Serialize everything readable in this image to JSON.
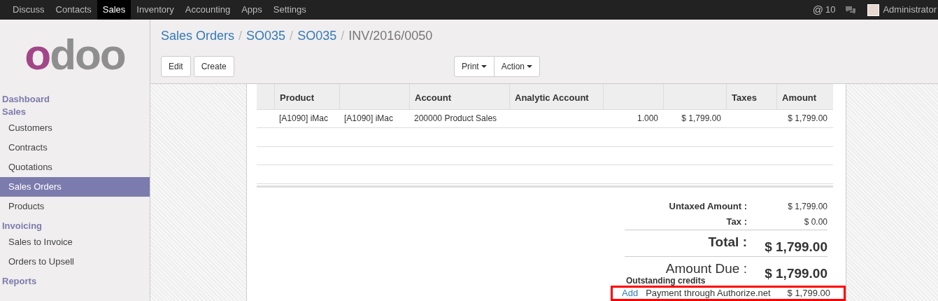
{
  "top_menu": [
    {
      "label": "Discuss",
      "selected": false
    },
    {
      "label": "Contacts",
      "selected": false
    },
    {
      "label": "Sales",
      "selected": true
    },
    {
      "label": "Inventory",
      "selected": false
    },
    {
      "label": "Accounting",
      "selected": false
    },
    {
      "label": "Apps",
      "selected": false
    },
    {
      "label": "Settings",
      "selected": false
    }
  ],
  "notifications": {
    "mention_icon": "@",
    "count": "10"
  },
  "user": {
    "name": "Administrator"
  },
  "logo": {
    "text": "odoo"
  },
  "sidebar": [
    {
      "kind": "heading",
      "label": "Dashboard",
      "selected": false
    },
    {
      "kind": "heading",
      "label": "Sales",
      "selected": false
    },
    {
      "kind": "item",
      "label": "Customers",
      "selected": false
    },
    {
      "kind": "item",
      "label": "Contracts",
      "selected": false
    },
    {
      "kind": "item",
      "label": "Quotations",
      "selected": false
    },
    {
      "kind": "item",
      "label": "Sales Orders",
      "selected": true
    },
    {
      "kind": "item",
      "label": "Products",
      "selected": false
    },
    {
      "kind": "heading",
      "label": "Invoicing",
      "selected": false
    },
    {
      "kind": "item",
      "label": "Sales to Invoice",
      "selected": false
    },
    {
      "kind": "item",
      "label": "Orders to Upsell",
      "selected": false
    },
    {
      "kind": "heading",
      "label": "Reports",
      "selected": false
    }
  ],
  "breadcrumb_separator": "/",
  "breadcrumbs": [
    {
      "label": "Sales Orders",
      "kind": "link"
    },
    {
      "label": "SO035",
      "kind": "link"
    },
    {
      "label": "SO035",
      "kind": "link"
    },
    {
      "label": "INV/2016/0050",
      "kind": "current"
    }
  ],
  "buttons": [
    "Edit",
    "Create"
  ],
  "dropdowns": [
    "Print",
    "Action"
  ],
  "table": {
    "columns": [
      {
        "label": "Product",
        "kind": "text"
      },
      {
        "kind": "text"
      },
      {
        "label": "Account",
        "kind": "text"
      },
      {
        "label": "Analytic Account",
        "kind": "text"
      },
      {
        "kind": "number"
      },
      {
        "kind": "number"
      },
      {
        "label": "Taxes",
        "kind": "text"
      },
      {
        "label": "Amount",
        "kind": "number"
      }
    ],
    "rows": [
      [
        "[A1090] iMac",
        "[A1090] iMac",
        "200000 Product Sales",
        null,
        "1.000",
        "$ 1,799.00",
        null,
        "$ 1,799.00"
      ]
    ]
  },
  "totals": [
    {
      "kind": "small",
      "label": "Untaxed Amount :",
      "value": "$ 1,799.00"
    },
    {
      "kind": "small",
      "label": "Tax :",
      "value": "$ 0.00"
    },
    {
      "kind": "big",
      "label": "Total :",
      "value": "$ 1,799.00"
    },
    {
      "kind": "due",
      "label": "Amount Due :",
      "value": "$ 1,799.00"
    }
  ],
  "outstanding_credits": {
    "title": "Outstanding credits",
    "action": "Add",
    "description": "Payment through Authorize.net",
    "amount": "$ 1,799.00",
    "highlighted": true
  }
}
